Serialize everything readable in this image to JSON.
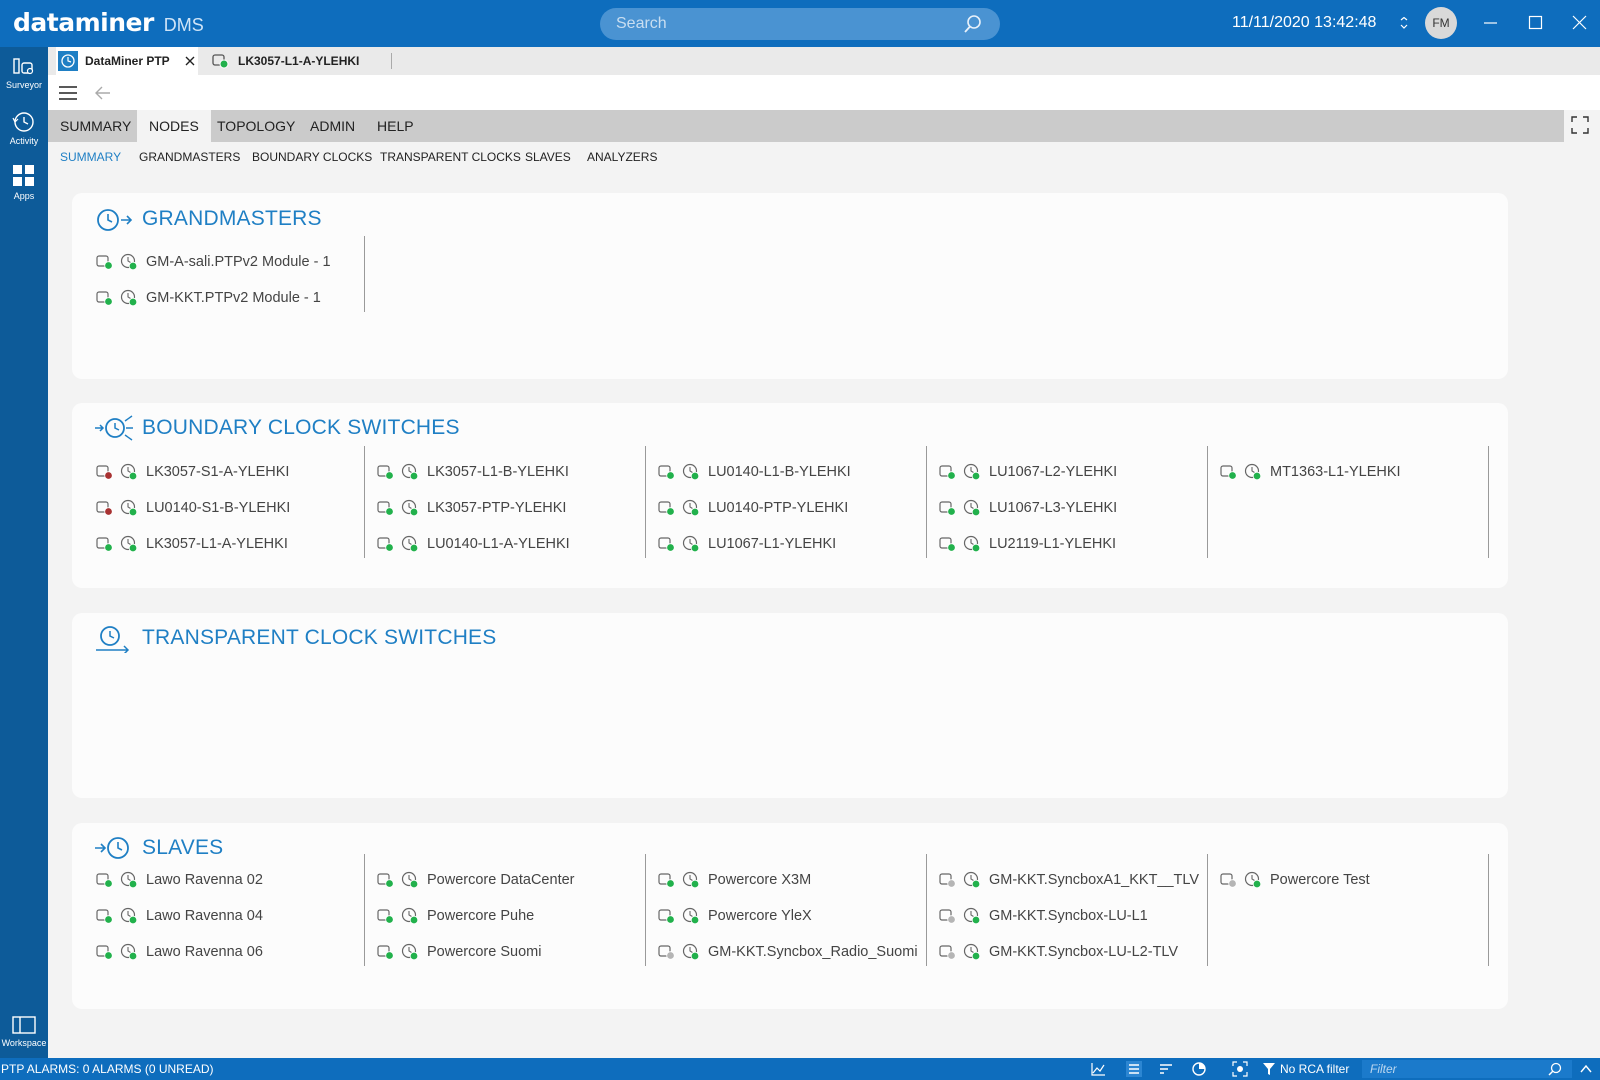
{
  "app": {
    "brand": "dataminer",
    "product": "DMS",
    "search_placeholder": "Search",
    "datetime": "11/11/2020 13:42:48",
    "user_initials": "FM",
    "accent_color": "#0e6dbd"
  },
  "rail": [
    {
      "label": "Surveyor",
      "icon": "surveyor-icon"
    },
    {
      "label": "Activity",
      "icon": "activity-icon"
    },
    {
      "label": "Apps",
      "icon": "apps-icon"
    },
    {
      "label": "Workspace",
      "icon": "workspace-icon"
    }
  ],
  "tabs": [
    {
      "label": "DataMiner PTP",
      "active": true,
      "icon": "ptp-app-icon",
      "closable": true
    },
    {
      "label": "LK3057-L1-A-YLEHKI",
      "active": false,
      "icon": "element-icon"
    }
  ],
  "main_nav": [
    "SUMMARY",
    "NODES",
    "TOPOLOGY",
    "ADMIN",
    "HELP"
  ],
  "main_nav_active": "NODES",
  "sub_nav": [
    "SUMMARY",
    "GRANDMASTERS",
    "BOUNDARY CLOCKS",
    "TRANSPARENT CLOCKS",
    "SLAVES",
    "ANALYZERS"
  ],
  "sub_nav_active": "SUMMARY",
  "sections": {
    "grandmasters": {
      "title": "GRANDMASTERS",
      "columns": [
        [
          {
            "name": "GM-A-sali.PTPv2 Module - 1",
            "status": "green"
          },
          {
            "name": "GM-KKT.PTPv2 Module - 1",
            "status": "green"
          }
        ]
      ]
    },
    "boundary": {
      "title": "BOUNDARY CLOCK SWITCHES",
      "columns": [
        [
          {
            "name": "LK3057-S1-A-YLEHKI",
            "status": "red"
          },
          {
            "name": "LU0140-S1-B-YLEHKI",
            "status": "red"
          },
          {
            "name": "LK3057-L1-A-YLEHKI",
            "status": "green"
          }
        ],
        [
          {
            "name": "LK3057-L1-B-YLEHKI",
            "status": "green"
          },
          {
            "name": "LK3057-PTP-YLEHKI",
            "status": "green"
          },
          {
            "name": "LU0140-L1-A-YLEHKI",
            "status": "green"
          }
        ],
        [
          {
            "name": "LU0140-L1-B-YLEHKI",
            "status": "green"
          },
          {
            "name": "LU0140-PTP-YLEHKI",
            "status": "green"
          },
          {
            "name": "LU1067-L1-YLEHKI",
            "status": "green"
          }
        ],
        [
          {
            "name": "LU1067-L2-YLEHKI",
            "status": "green"
          },
          {
            "name": "LU1067-L3-YLEHKI",
            "status": "green"
          },
          {
            "name": "LU2119-L1-YLEHKI",
            "status": "green"
          }
        ],
        [
          {
            "name": "MT1363-L1-YLEHKI",
            "status": "green"
          }
        ]
      ]
    },
    "transparent": {
      "title": "TRANSPARENT CLOCK SWITCHES",
      "columns": []
    },
    "slaves": {
      "title": "SLAVES",
      "columns": [
        [
          {
            "name": "Lawo Ravenna 02",
            "status": "green"
          },
          {
            "name": "Lawo Ravenna 04",
            "status": "green"
          },
          {
            "name": "Lawo Ravenna 06",
            "status": "green"
          }
        ],
        [
          {
            "name": "Powercore DataCenter",
            "status": "green"
          },
          {
            "name": "Powercore Puhe",
            "status": "green"
          },
          {
            "name": "Powercore Suomi",
            "status": "green"
          }
        ],
        [
          {
            "name": "Powercore X3M",
            "status": "green"
          },
          {
            "name": "Powercore YleX",
            "status": "green"
          },
          {
            "name": "GM-KKT.Syncbox_Radio_Suomi",
            "status": "grey"
          }
        ],
        [
          {
            "name": "GM-KKT.SyncboxA1_KKT__TLV",
            "status": "grey"
          },
          {
            "name": "GM-KKT.Syncbox-LU-L1",
            "status": "grey"
          },
          {
            "name": "GM-KKT.Syncbox-LU-L2-TLV",
            "status": "grey"
          }
        ],
        [
          {
            "name": "Powercore Test",
            "status": "grey"
          }
        ]
      ]
    }
  },
  "status_colors": {
    "green": "#22b14c",
    "red": "#a83232",
    "grey": "#b5b5b5"
  },
  "statusbar": {
    "alarms_text": "PTP ALARMS: 0 ALARMS (0 UNREAD)",
    "rca_text": "No RCA filter",
    "filter_placeholder": "Filter"
  }
}
